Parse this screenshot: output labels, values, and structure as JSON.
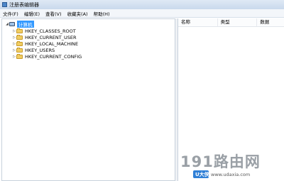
{
  "window": {
    "title": "注册表编辑器"
  },
  "menu": [
    {
      "label": "文件(F)"
    },
    {
      "label": "编辑(E)"
    },
    {
      "label": "查看(V)"
    },
    {
      "label": "收藏夹(A)"
    },
    {
      "label": "帮助(H)"
    }
  ],
  "tree": {
    "root": {
      "label": "计算机",
      "expanded": true
    },
    "children": [
      {
        "label": "HKEY_CLASSES_ROOT"
      },
      {
        "label": "HKEY_CURRENT_USER"
      },
      {
        "label": "HKEY_LOCAL_MACHINE"
      },
      {
        "label": "HKEY_USERS"
      },
      {
        "label": "HKEY_CURRENT_CONFIG"
      }
    ]
  },
  "list": {
    "columns": [
      {
        "label": "名称"
      },
      {
        "label": "类型"
      },
      {
        "label": "数据"
      }
    ]
  },
  "watermark": {
    "big_text": "191路由网",
    "badge_text": "U大侠",
    "url": "www.udaxia.com"
  },
  "colors": {
    "selection": "#3399ff",
    "folder": "#f1cd62"
  }
}
